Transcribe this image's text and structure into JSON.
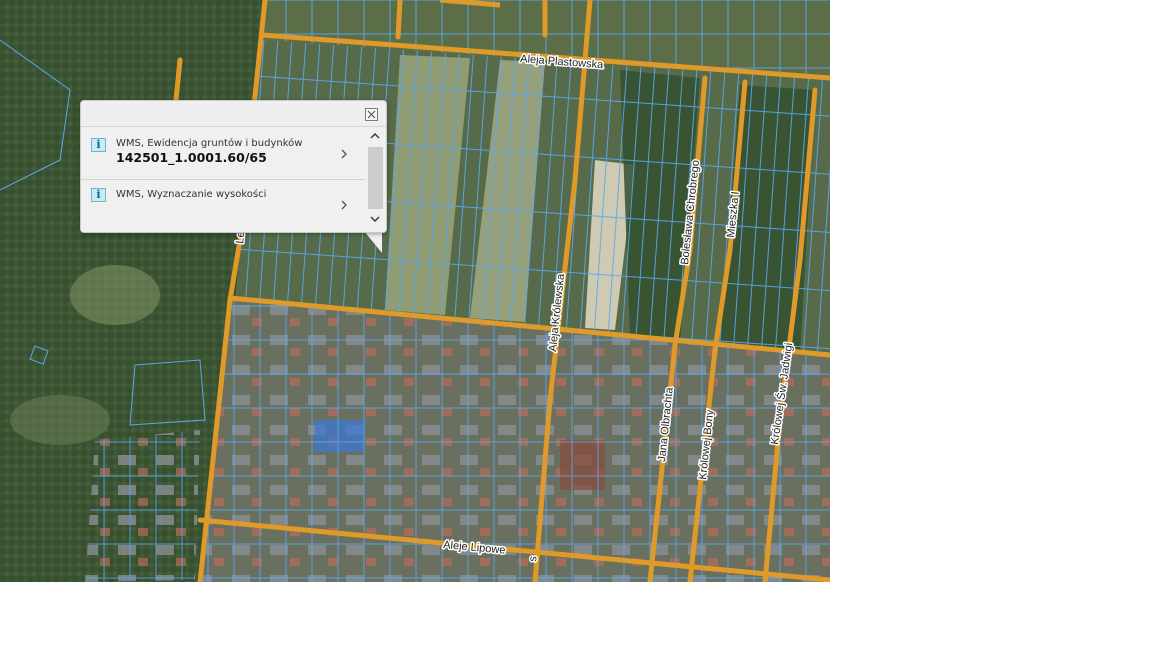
{
  "map": {
    "streets": [
      {
        "id": "aleja-plastowska",
        "label": "Aleja Plastowska"
      },
      {
        "id": "aleja-krolewska",
        "label": "Aleja Królewska"
      },
      {
        "id": "boleslawa-chrobrego",
        "label": "Bolesława Chrobrego"
      },
      {
        "id": "mieszka-i",
        "label": "Mieszka I"
      },
      {
        "id": "jana-olbrachta",
        "label": "Jana Olbrachta"
      },
      {
        "id": "krolowej-bony",
        "label": "Królowej Bony"
      },
      {
        "id": "krolowej-sw-jadwigi",
        "label": "Królowej Św. Jadwigi"
      },
      {
        "id": "aleje-lipowe",
        "label": "Aleje Lipowe"
      },
      {
        "id": "le-fragment",
        "label": "Le"
      },
      {
        "id": "s-fragment",
        "label": "s"
      }
    ],
    "colors": {
      "road": "#e09a2a",
      "parcel": "#5aa8f0",
      "forest": "#3f5a35",
      "field": "#8c9a78"
    }
  },
  "popup": {
    "items": [
      {
        "layer_title": "WMS, Ewidencja gruntów i budynków",
        "value": "142501_1.0001.60/65",
        "icon": "info-icon"
      },
      {
        "layer_title": "WMS, Wyznaczanie wysokości",
        "value": "",
        "icon": "info-icon"
      }
    ]
  }
}
